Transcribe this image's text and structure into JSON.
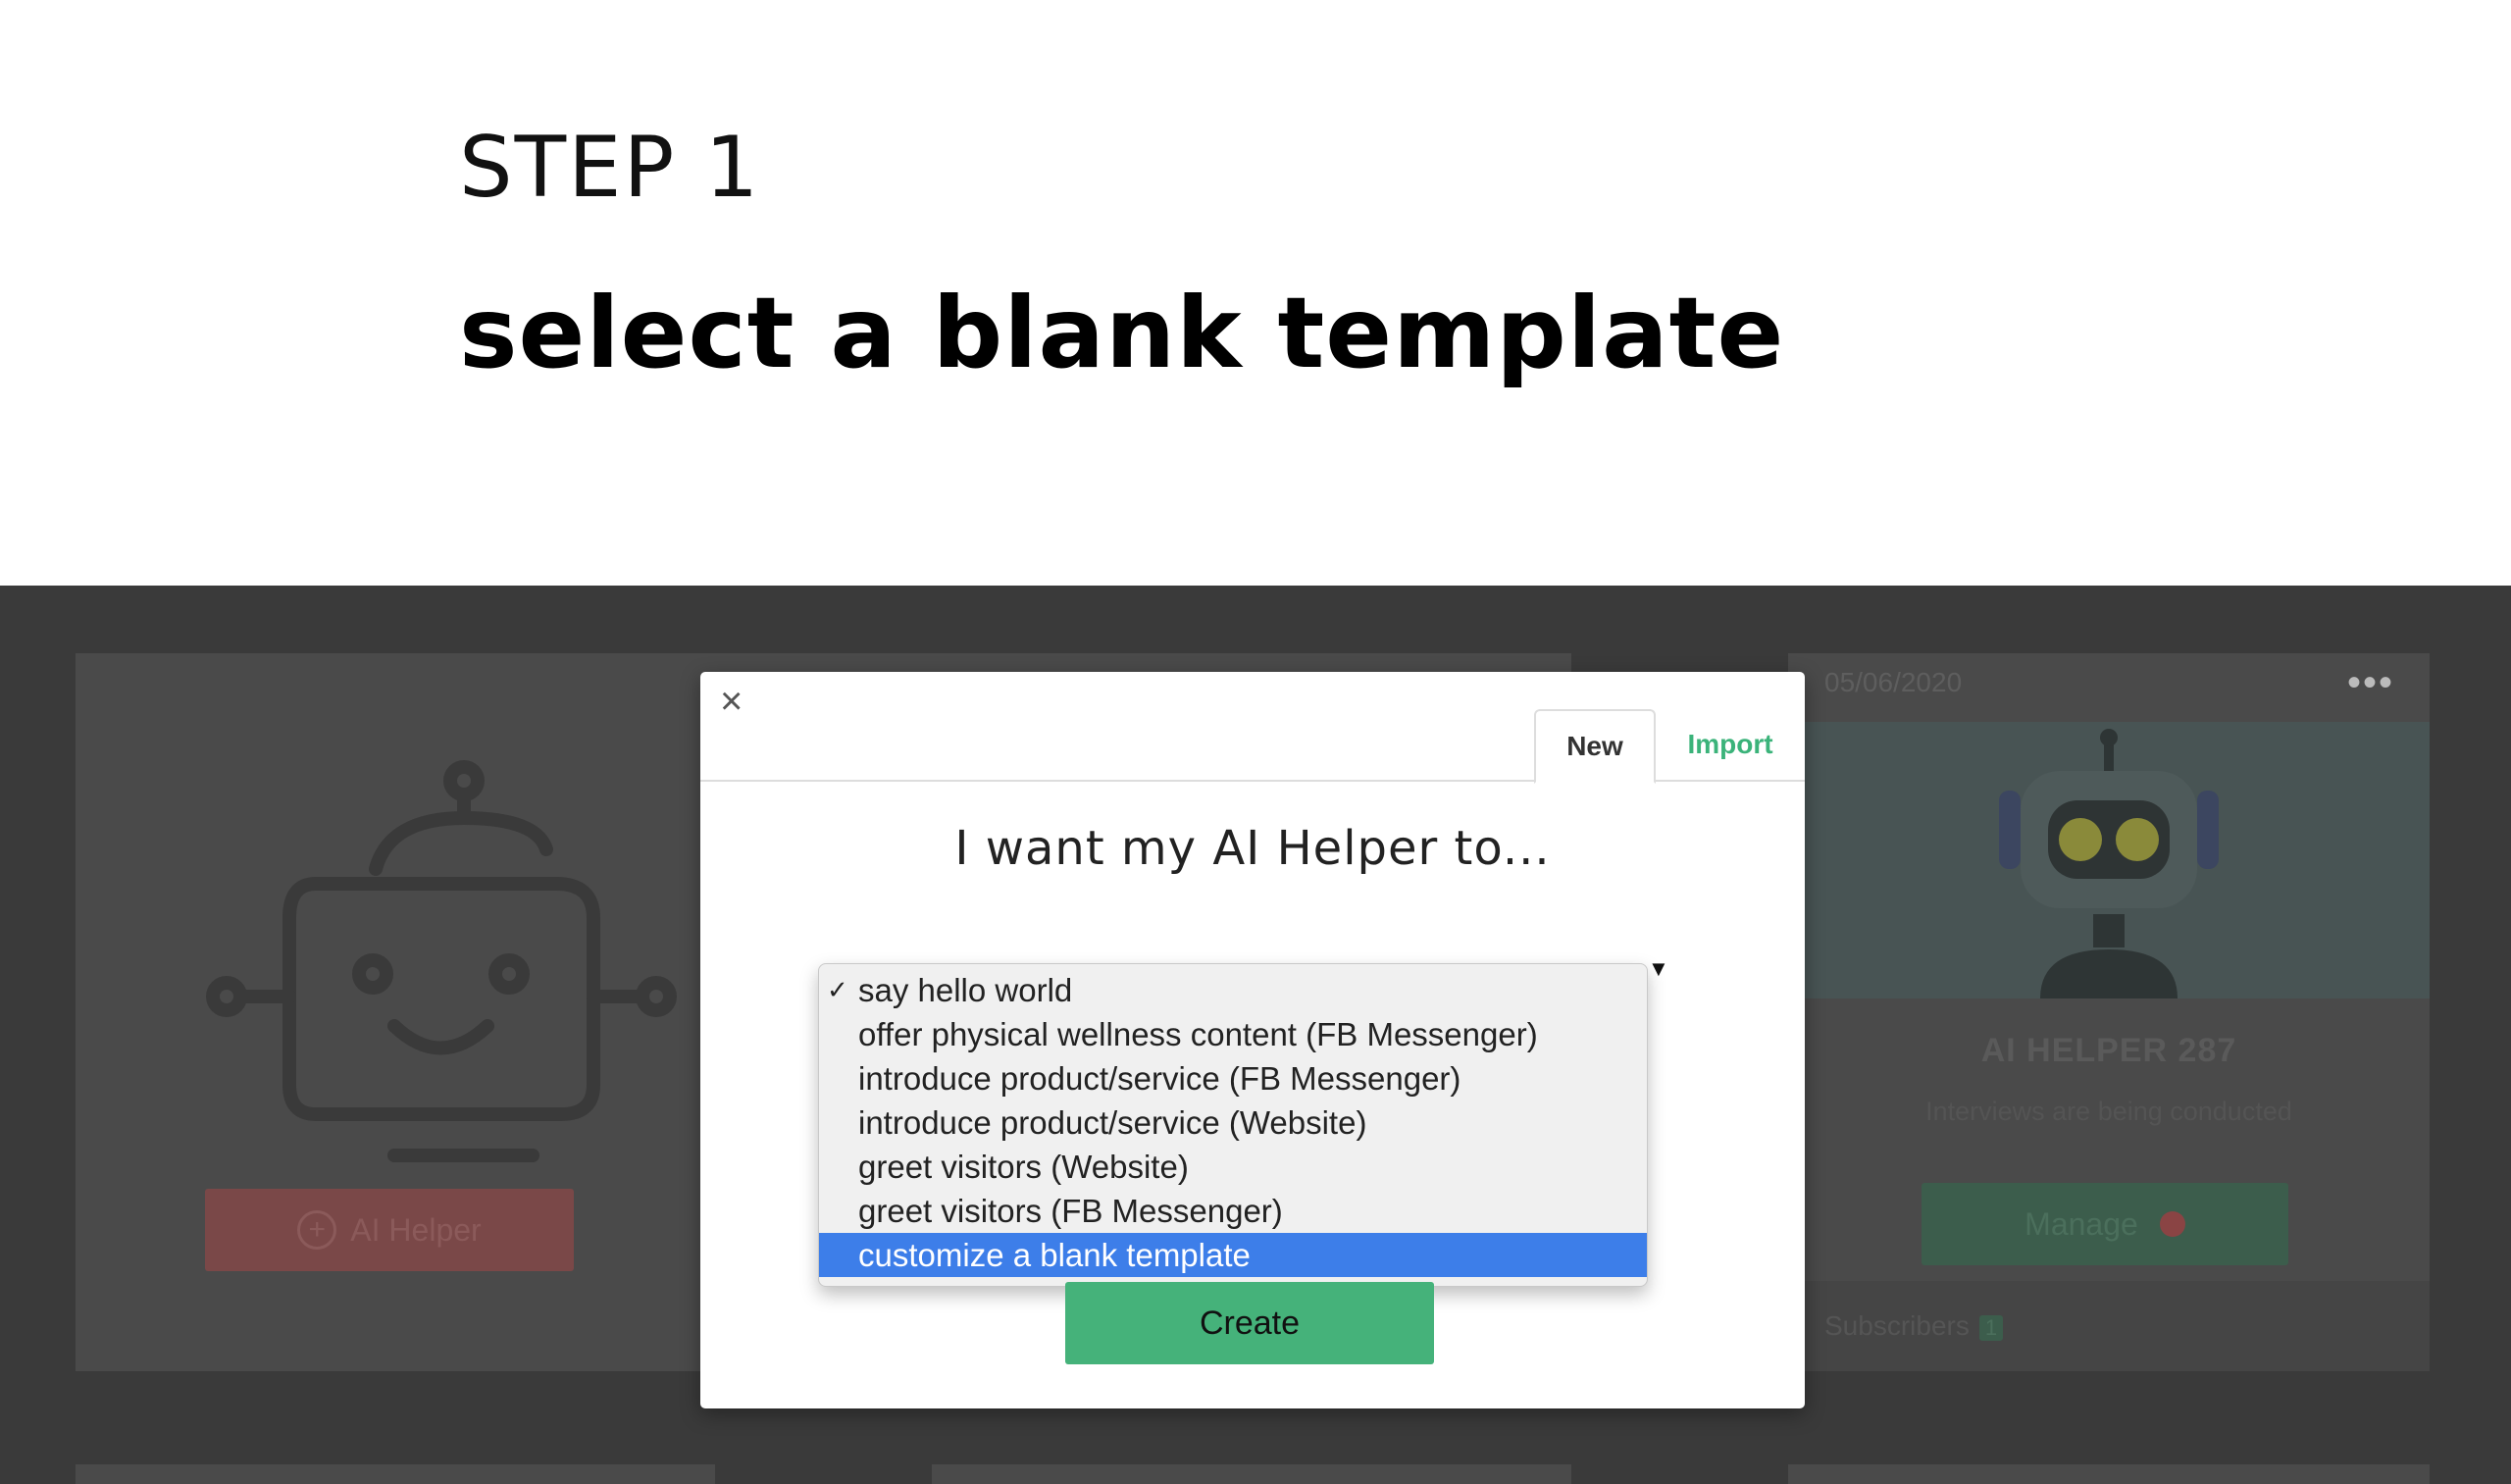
{
  "header": {
    "step": "STEP 1",
    "title": "select a blank template"
  },
  "background": {
    "left_card": {
      "button_label": "AI Helper"
    },
    "right_card": {
      "date": "05/06/2020",
      "menu": "•••",
      "name": "AI HELPER 287",
      "status": "Interviews are being conducted",
      "manage_label": "Manage",
      "subscribers_label": "Subscribers",
      "subscribers_count": "1"
    }
  },
  "modal": {
    "close": "×",
    "tabs": [
      {
        "label": "New",
        "active": true
      },
      {
        "label": "Import",
        "active": false
      }
    ],
    "heading": "I want my AI Helper to...",
    "select_arrow": "▼",
    "options": [
      {
        "label": "say hello world",
        "checked": true
      },
      {
        "label": "offer physical wellness content (FB Messenger)"
      },
      {
        "label": "introduce product/service (FB Messenger)"
      },
      {
        "label": "introduce product/service (Website)"
      },
      {
        "label": "greet visitors (Website)"
      },
      {
        "label": "greet visitors (FB Messenger)"
      },
      {
        "label": "customize a blank template",
        "highlighted": true
      }
    ],
    "check_mark": "✓",
    "create_label": "Create"
  },
  "colors": {
    "accent_green": "#45b27a",
    "highlight_blue": "#3d7ee9",
    "overlay": "#3a3a3a"
  }
}
